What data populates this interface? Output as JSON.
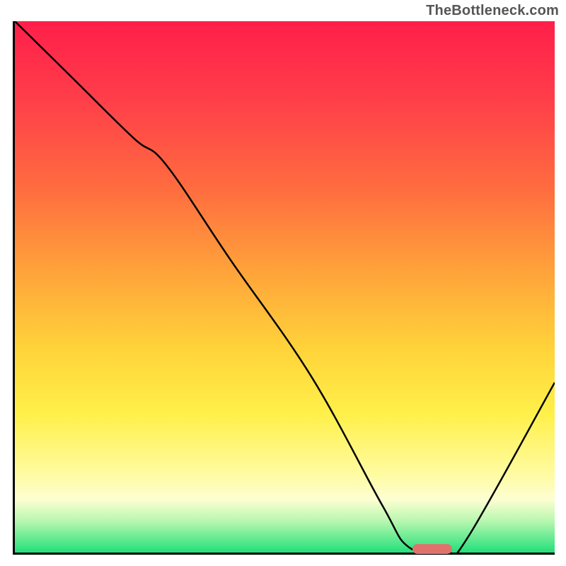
{
  "attribution": "TheBottleneck.com",
  "chart_data": {
    "type": "line",
    "title": "",
    "xlabel": "",
    "ylabel": "",
    "xlim": [
      0,
      100
    ],
    "ylim": [
      0,
      100
    ],
    "grid": false,
    "legend": false,
    "background_gradient": {
      "direction": "vertical",
      "stops": [
        {
          "pos": 0,
          "hex": "#ff1f4a"
        },
        {
          "pos": 14,
          "hex": "#ff3c4a"
        },
        {
          "pos": 32,
          "hex": "#ff6e3f"
        },
        {
          "pos": 48,
          "hex": "#ffa63a"
        },
        {
          "pos": 62,
          "hex": "#ffd43a"
        },
        {
          "pos": 74,
          "hex": "#fff04a"
        },
        {
          "pos": 85,
          "hex": "#fffb9f"
        },
        {
          "pos": 90,
          "hex": "#fdfed2"
        },
        {
          "pos": 94,
          "hex": "#b9f7b0"
        },
        {
          "pos": 100,
          "hex": "#22e07a"
        }
      ]
    },
    "series": [
      {
        "name": "bottleneck-curve",
        "stroke": "#000000",
        "stroke_width": 2.5,
        "x": [
          0,
          10,
          22,
          28,
          40,
          55,
          68,
          73,
          80,
          84,
          100
        ],
        "y": [
          100,
          90,
          78,
          73,
          55,
          33,
          9,
          1,
          0,
          3,
          32
        ]
      }
    ],
    "marker": {
      "name": "optimal-range-marker",
      "x": 77,
      "y": 1,
      "hex": "#e0726e"
    }
  }
}
